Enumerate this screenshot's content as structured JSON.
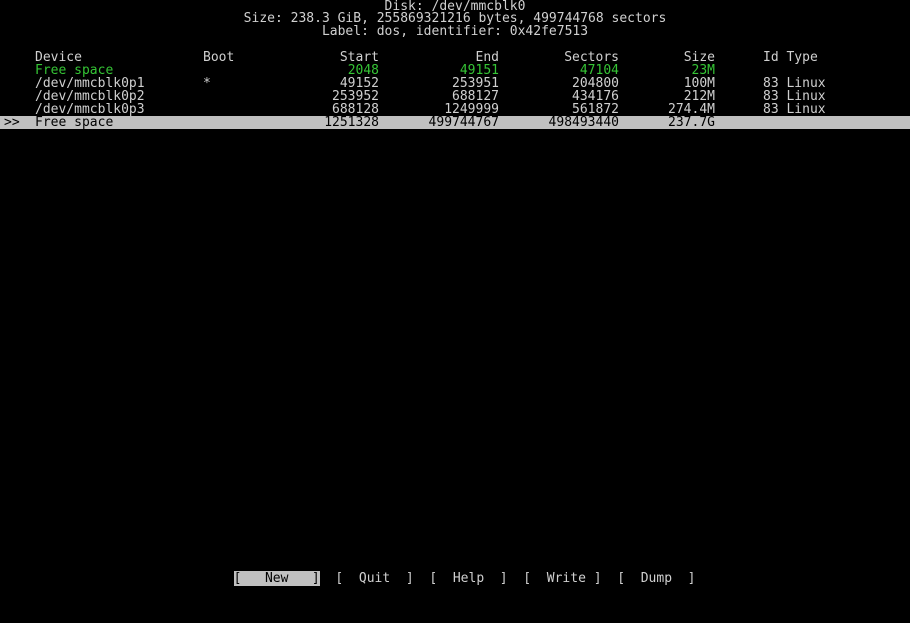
{
  "header": {
    "disk": "Disk: /dev/mmcblk0",
    "size": "Size: 238.3 GiB, 255869321216 bytes, 499744768 sectors",
    "label": "Label: dos, identifier: 0x42fe7513"
  },
  "columns": {
    "device": "Device",
    "boot": "Boot",
    "start": "Start",
    "end": "End",
    "sectors": "Sectors",
    "size": "Size",
    "id_type": "Id Type"
  },
  "rows": [
    {
      "marker": "",
      "device": "Free space",
      "boot": "",
      "start": "2048",
      "end": "49151",
      "sectors": "47104",
      "size": "23M",
      "id_type": ""
    },
    {
      "marker": "",
      "device": "/dev/mmcblk0p1",
      "boot": "*",
      "start": "49152",
      "end": "253951",
      "sectors": "204800",
      "size": "100M",
      "id_type": "83 Linux"
    },
    {
      "marker": "",
      "device": "/dev/mmcblk0p2",
      "boot": "",
      "start": "253952",
      "end": "688127",
      "sectors": "434176",
      "size": "212M",
      "id_type": "83 Linux"
    },
    {
      "marker": "",
      "device": "/dev/mmcblk0p3",
      "boot": "",
      "start": "688128",
      "end": "1249999",
      "sectors": "561872",
      "size": "274.4M",
      "id_type": "83 Linux"
    },
    {
      "marker": ">>",
      "device": "Free space",
      "boot": "",
      "start": "1251328",
      "end": "499744767",
      "sectors": "498493440",
      "size": "237.7G",
      "id_type": ""
    }
  ],
  "menu": {
    "new": "New",
    "quit": "Quit",
    "help": "Help",
    "write": "Write",
    "dump": "Dump"
  },
  "colors": {
    "free_space": "#35c435",
    "selected_bg": "#c0c0c0",
    "text": "#d0d0d0",
    "background": "#000000"
  }
}
